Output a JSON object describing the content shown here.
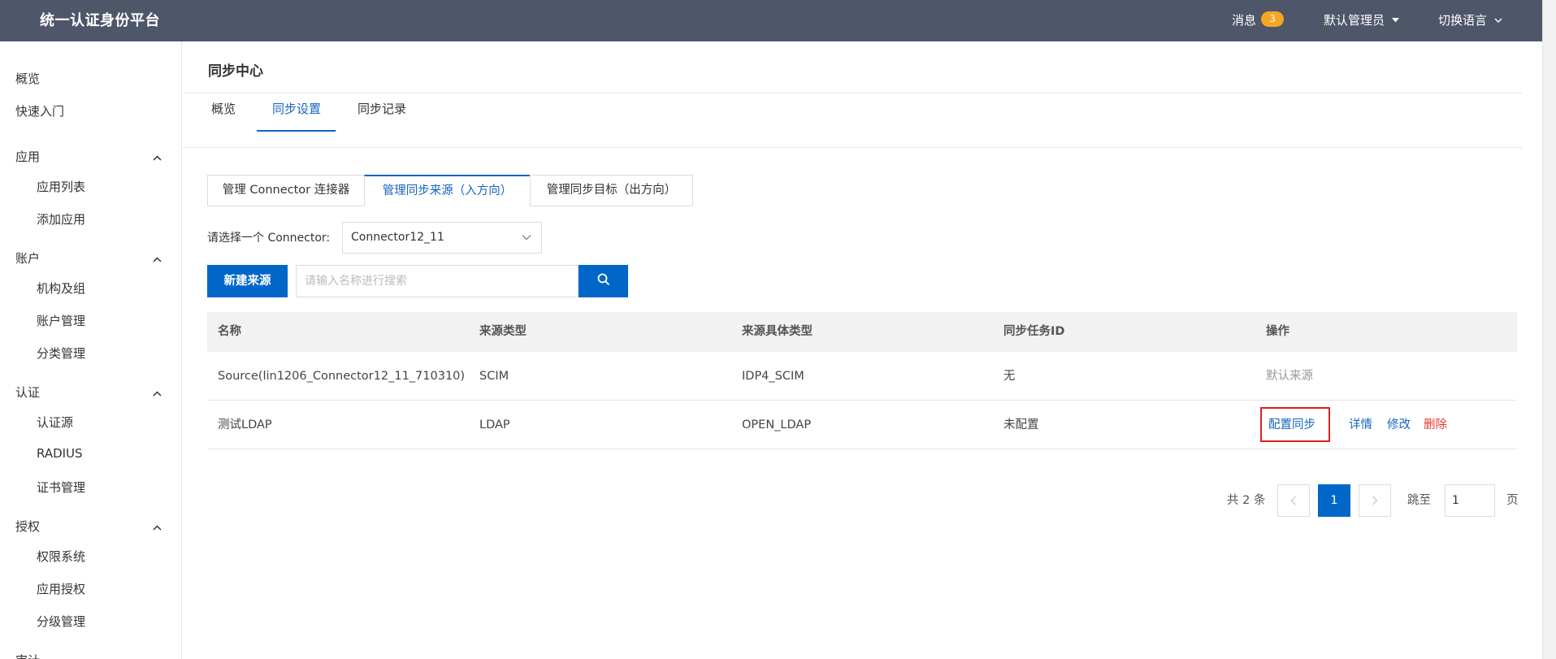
{
  "header": {
    "brand": "统一认证身份平台",
    "messages_label": "消息",
    "messages_count": "3",
    "user_label": "默认管理员",
    "language_label": "切换语言"
  },
  "sidebar": {
    "overview": "概览",
    "quickstart": "快速入门",
    "groups": [
      {
        "label": "应用",
        "items": [
          "应用列表",
          "添加应用"
        ]
      },
      {
        "label": "账户",
        "items": [
          "机构及组",
          "账户管理",
          "分类管理"
        ]
      },
      {
        "label": "认证",
        "items": [
          "认证源",
          "RADIUS",
          "证书管理"
        ]
      },
      {
        "label": "授权",
        "items": [
          "权限系统",
          "应用授权",
          "分级管理"
        ]
      },
      {
        "label": "审计",
        "items": []
      }
    ]
  },
  "main": {
    "page_title": "同步中心",
    "tabs": [
      {
        "label": "概览",
        "active": false
      },
      {
        "label": "同步设置",
        "active": true
      },
      {
        "label": "同步记录",
        "active": false
      }
    ],
    "subtabs": [
      {
        "label": "管理 Connector 连接器",
        "active": false
      },
      {
        "label": "管理同步来源（入方向）",
        "active": true
      },
      {
        "label": "管理同步目标（出方向）",
        "active": false
      }
    ],
    "connector_select_label": "请选择一个 Connector:",
    "connector_selected": "Connector12_11",
    "new_source_button": "新建来源",
    "search_placeholder": "请输入名称进行搜索",
    "table": {
      "columns": [
        "名称",
        "来源类型",
        "来源具体类型",
        "同步任务ID",
        "操作"
      ],
      "rows": [
        {
          "name": "Source(lin1206_Connector12_11_710310)",
          "type": "SCIM",
          "subtype": "IDP4_SCIM",
          "task_id": "无",
          "action_text": "默认来源"
        },
        {
          "name": "测试LDAP",
          "type": "LDAP",
          "subtype": "OPEN_LDAP",
          "task_id": "未配置",
          "actions": {
            "configure": "配置同步",
            "details": "详情",
            "edit": "修改",
            "delete": "删除"
          }
        }
      ]
    },
    "pagination": {
      "total_text": "共 2 条",
      "current_page": "1",
      "jump_label": "跳至",
      "jump_value": "1",
      "page_suffix": "页"
    }
  },
  "colors": {
    "header_bg": "#4e5669",
    "primary": "#0067c8",
    "danger": "#e53935",
    "badge": "#f5a623",
    "highlight": "#e02020"
  }
}
